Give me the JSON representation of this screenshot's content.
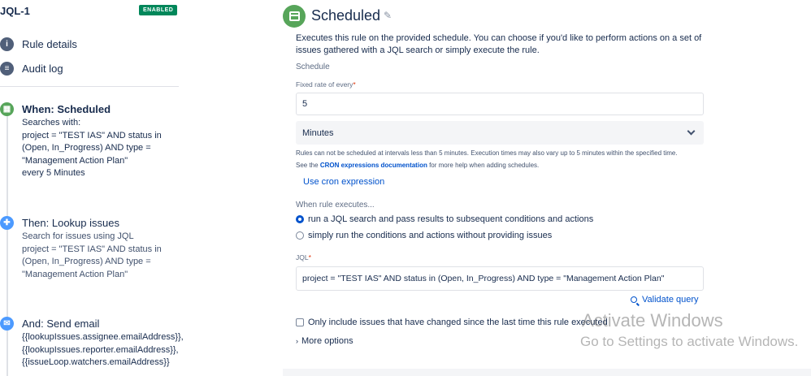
{
  "rule": {
    "name": "JQL-1",
    "status_badge": "ENABLED",
    "nav": [
      {
        "label": "Rule details",
        "icon": "info-icon"
      },
      {
        "label": "Audit log",
        "icon": "audit-log-icon"
      }
    ]
  },
  "steps": [
    {
      "title": "When: Scheduled",
      "icon": "calendar-icon",
      "color": "#57a55a",
      "lines": [
        "Searches with:",
        "project = \"TEST IAS\" AND status in",
        "(Open, In_Progress) AND type =",
        "\"Management Action Plan\"",
        "every 5 Minutes"
      ]
    },
    {
      "title": "Then: Lookup issues",
      "icon": "plus-icon",
      "color": "#4c9aff",
      "lines": [
        "Search for issues using JQL",
        "project = \"TEST IAS\" AND status in",
        "(Open, In_Progress) AND type =",
        "\"Management Action Plan\""
      ]
    },
    {
      "title": "And: Send email",
      "icon": "email-icon",
      "color": "#4c9aff",
      "lines": [
        "{{lookupIssues.assignee.emailAddress}},",
        "{{lookupIssues.reporter.emailAddress}},",
        "{{issueLoop.watchers.emailAddress}}"
      ]
    }
  ],
  "panel": {
    "title": "Scheduled",
    "description": "Executes this rule on the provided schedule. You can choose if you'd like to perform actions on a set of issues gathered with a JQL search or simply execute the rule.",
    "section_label": "Schedule",
    "fixed_rate_label": "Fixed rate of every",
    "fixed_rate_value": "5",
    "unit_value": "Minutes",
    "help_line1": "Rules can not be scheduled at intervals less than 5 minutes. Execution times may also vary up to 5 minutes within the specified time.",
    "help_see": "See the ",
    "help_link": "CRON expressions documentation",
    "help_rest": " for more help when adding schedules.",
    "cron_link": "Use cron expression",
    "when_label": "When rule executes...",
    "radio_1": "run a JQL search and pass results to subsequent conditions and actions",
    "radio_2": "simply run the conditions and actions without providing issues",
    "jql_label": "JQL",
    "jql_value": "project = \"TEST IAS\" AND status in (Open, In_Progress) AND type = \"Management Action Plan\"",
    "validate_label": "Validate query",
    "only_include": "Only include issues that have changed since the last time this rule executed",
    "more_options": "More options"
  },
  "watermark": {
    "line1": "Activate Windows",
    "line2": "Go to Settings to activate Windows."
  }
}
